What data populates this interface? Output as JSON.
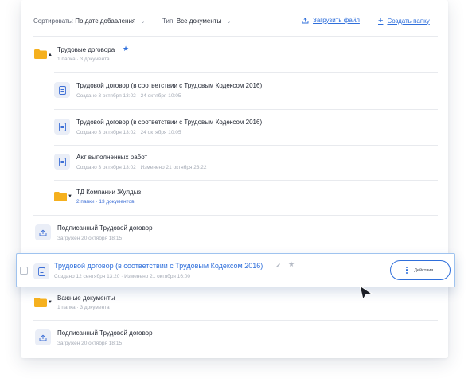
{
  "toolbar": {
    "sort_label": "Сортировать:",
    "sort_value": "По дате добавления",
    "type_label": "Тип:",
    "type_value": "Все документы",
    "upload_label": "Загрузить файл",
    "create_label": "Создать папку"
  },
  "items": [
    {
      "kind": "folder",
      "title": "Трудовые договора",
      "starred": true,
      "expanded": true,
      "meta_a": "1 папка",
      "meta_b": "3 документа"
    },
    {
      "kind": "document",
      "title": "Трудовой договор (в соответствии с Трудовым Кодексом 2016)",
      "meta_a": "Создано 3 октября 13:02",
      "meta_b": "24 октября 10:05"
    },
    {
      "kind": "document",
      "title": "Трудовой договор (в соответствии с Трудовым Кодексом 2016)",
      "meta_a": "Создано 3 октября 13:02",
      "meta_b": "24 октября 10:05"
    },
    {
      "kind": "document",
      "title": "Акт выполненных работ",
      "meta_a": "Создано 3 октября 13:02",
      "meta_b": "Изменено 21 октября 23:22"
    },
    {
      "kind": "folder",
      "title": "ТД Компании Жулдыз",
      "meta_a": "2 папки",
      "meta_b": "13 документов"
    },
    {
      "kind": "upload",
      "title": "Подписанный Трудовой договор",
      "meta_a": "Загружен 20 октября 18:15"
    },
    {
      "kind": "document-selected",
      "title": "Трудовой договор (в соответствии с Трудовым Кодексом 2016)",
      "meta_a": "Создано 12 сентября 13:20",
      "meta_b": "Изменено 21 октября 16:00",
      "actions_label": "Действия"
    },
    {
      "kind": "folder",
      "title": "Важные документы",
      "meta_a": "1 папка",
      "meta_b": "3 документа"
    },
    {
      "kind": "upload",
      "title": "Подписанный Трудовой договор",
      "meta_a": "Загружен 20 октября 18:15"
    }
  ],
  "colors": {
    "accent": "#2f6fdb",
    "folder": "#f5b01e",
    "muted": "#a5abb6",
    "selected_border": "#9fc3ef"
  },
  "icons": {
    "folder": "folder-icon",
    "document": "document-icon",
    "upload": "upload-icon",
    "star": "star-icon",
    "pencil": "pencil-icon",
    "more": "more-vertical-icon",
    "cursor": "cursor-arrow-icon"
  }
}
